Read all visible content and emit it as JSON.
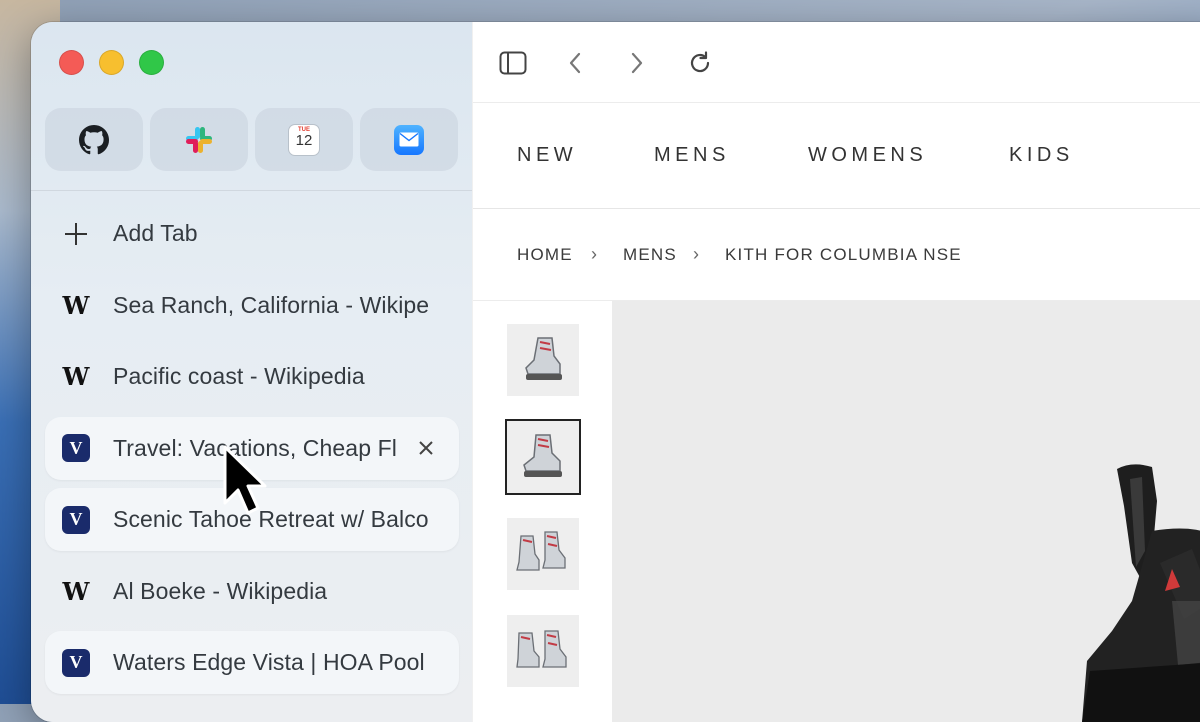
{
  "window": {
    "traffic_lights": [
      "close",
      "minimize",
      "zoom"
    ]
  },
  "sidebar": {
    "pinned": [
      {
        "name": "github-icon",
        "color": "#1b1f23"
      },
      {
        "name": "slack-icon",
        "color": "#e01e5a"
      },
      {
        "name": "calendar-icon",
        "day": "TUE",
        "date": "12"
      },
      {
        "name": "mail-icon",
        "color": "#1e90ff"
      }
    ],
    "add_tab_label": "Add Tab",
    "tabs": [
      {
        "label": "Sea Ranch, California - Wikipe",
        "favicon": "wikipedia-icon",
        "favicon_text": "W"
      },
      {
        "label": "Pacific coast - Wikipedia",
        "favicon": "wikipedia-icon",
        "favicon_text": "W"
      },
      {
        "label": "Travel: Vacations, Cheap Fl",
        "favicon": "vrbo-icon",
        "favicon_text": "V",
        "active": true
      },
      {
        "label": "Scenic Tahoe Retreat w/ Balco",
        "favicon": "vrbo-icon",
        "favicon_text": "V"
      },
      {
        "label": "Al Boeke - Wikipedia",
        "favicon": "wikipedia-icon",
        "favicon_text": "W"
      },
      {
        "label": "Waters Edge Vista | HOA Pool",
        "favicon": "vrbo-icon",
        "favicon_text": "V"
      }
    ]
  },
  "toolbar": {
    "buttons": [
      "sidebar-toggle-icon",
      "back-icon",
      "forward-icon",
      "reload-icon"
    ]
  },
  "site": {
    "nav": [
      "NEW",
      "MENS",
      "WOMENS",
      "KIDS"
    ],
    "breadcrumb": [
      "HOME",
      "MENS",
      "KITH FOR COLUMBIA NSE"
    ],
    "breadcrumb_sep": "›",
    "thumbnails": 4,
    "selected_thumbnail": 2
  },
  "colors": {
    "accent_red": "#f45b56",
    "accent_yellow": "#f7bf2f",
    "accent_green": "#30c748",
    "vrbo_blue": "#1a2b6b"
  }
}
